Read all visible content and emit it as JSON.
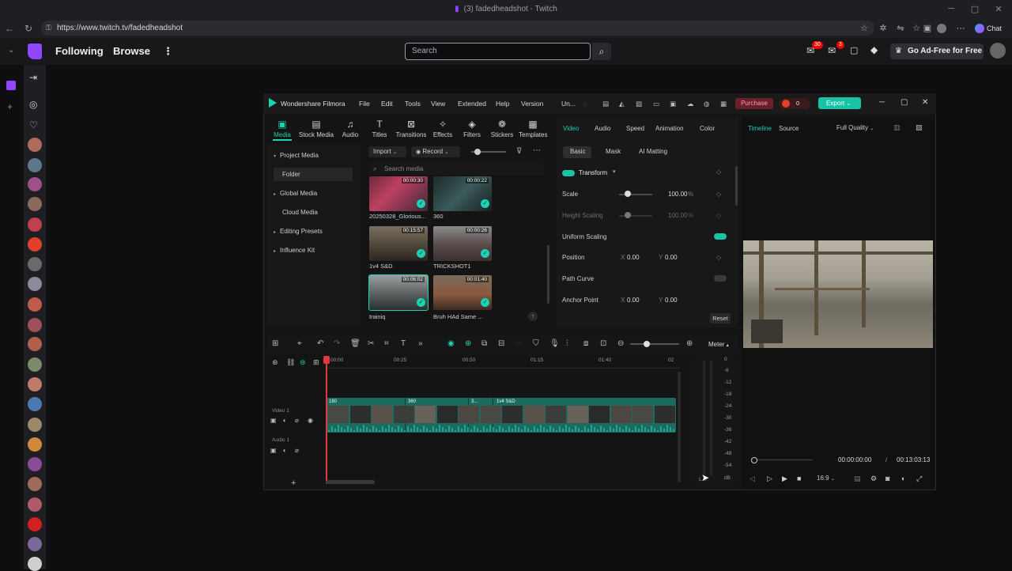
{
  "browser": {
    "title": "(3) fadedheadshot - Twitch",
    "url": "https://www.twitch.tv/fadedheadshot"
  },
  "twitch": {
    "nav_following": "Following",
    "nav_browse": "Browse",
    "search_placeholder": "Search",
    "notif_badge_1": "30",
    "notif_badge_2": "3",
    "ad_free": "Go Ad-Free for Free"
  },
  "filmora": {
    "app_name": "Wondershare Filmora",
    "menu": [
      "File",
      "Edit",
      "Tools",
      "View",
      "Extended",
      "Help",
      "Version"
    ],
    "project_short": "Un...",
    "purchase": "Purchase",
    "credits": "0",
    "export": "Export",
    "toolbar": [
      "Media",
      "Stock Media",
      "Audio",
      "Titles",
      "Transitions",
      "Effects",
      "Filters",
      "Stickers",
      "Templates"
    ],
    "left_nav": [
      "Project Media",
      "Folder",
      "Global Media",
      "Cloud Media",
      "Editing Presets",
      "Influence Kit"
    ],
    "import": "Import",
    "record": "Record",
    "search_media": "Search media",
    "media": [
      {
        "name": "20250328_Glorious...",
        "duration": "00:00:30"
      },
      {
        "name": "360",
        "duration": "00:00:22"
      },
      {
        "name": "1v4 S&D",
        "duration": "00:15:57"
      },
      {
        "name": "TRICKSHOT1",
        "duration": "00:00:26"
      },
      {
        "name": "trainiq",
        "duration": "00:06:02"
      },
      {
        "name": "Bruh HAd Same ...",
        "duration": "00:01:40"
      }
    ],
    "prop_tabs": [
      "Video",
      "Audio",
      "Speed",
      "Animation",
      "Color"
    ],
    "prop_subtabs": [
      "Basic",
      "Mask",
      "AI Matting"
    ],
    "transform": "Transform",
    "scale_label": "Scale",
    "scale_value": "100.00",
    "scale_unit": "%",
    "height_scaling_label": "Height Scaling",
    "height_scaling_value": "100.00",
    "uniform_scaling_label": "Uniform Scaling",
    "position_label": "Position",
    "pos_x_label": "X",
    "pos_x": "0.00",
    "pos_y_label": "Y",
    "pos_y": "0.00",
    "path_curve_label": "Path Curve",
    "anchor_point_label": "Anchor Point",
    "anchor_x": "0.00",
    "anchor_y": "0.00",
    "reset": "Reset",
    "preview_tabs": [
      "Timeline",
      "Source"
    ],
    "quality": "Full Quality",
    "time_current": "00:00:00:00",
    "time_separator": "/",
    "time_total": "00:13:03:13",
    "aspect": "16:9",
    "meter_label": "Meter",
    "ruler": [
      "00:00",
      "00:25",
      "00:50",
      "01:15",
      "01:40",
      "02"
    ],
    "track_video": "Video 1",
    "track_audio": "Audio 1",
    "clip_labels": [
      "180",
      "360",
      "3...",
      "1v4 S&D"
    ],
    "db_scale": [
      "0",
      "-6",
      "-12",
      "-18",
      "-24",
      "-30",
      "-36",
      "-42",
      "-48",
      "-54",
      "dB"
    ],
    "meter_lr": "L   R"
  }
}
